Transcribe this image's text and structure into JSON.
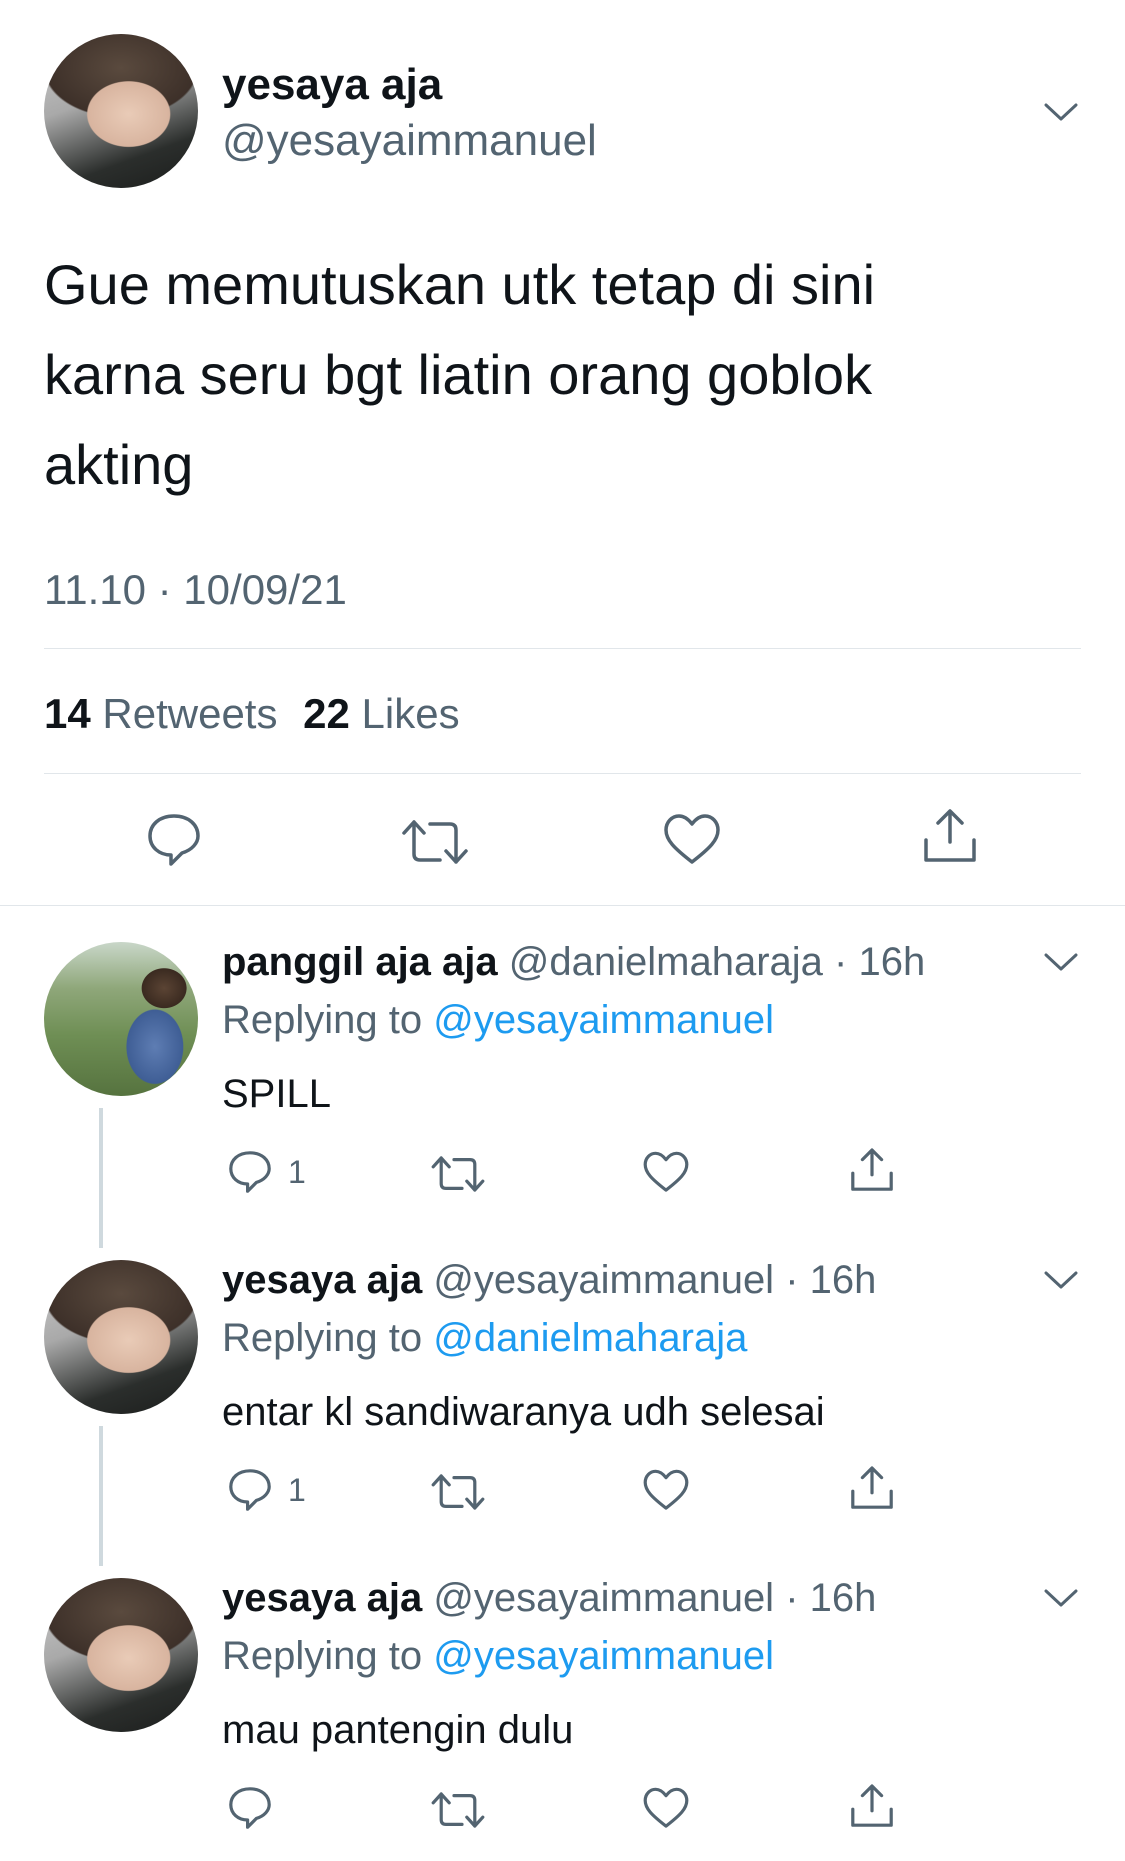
{
  "tweet": {
    "display_name": "yesaya aja",
    "handle": "@yesayaimmanuel",
    "text_lines": [
      "Gue memutuskan utk tetap di sini",
      "karna seru bgt liatin orang goblok",
      "akting"
    ],
    "time": "11.10 · 10/09/21",
    "retweets_count": "14",
    "retweets_label": "Retweets",
    "likes_count": "22",
    "likes_label": "Likes",
    "actions": [
      "reply-icon",
      "retweet-icon",
      "like-icon",
      "share-icon"
    ]
  },
  "replies": [
    {
      "display_name": "panggil aja aja",
      "handle": "@danielmaharaja",
      "time": "· 16h",
      "replying_prefix": "Replying to",
      "replying_to": "@yesayaimmanuel",
      "text": "SPILL",
      "reply_count": "1"
    },
    {
      "display_name": "yesaya aja",
      "handle": "@yesayaimmanuel",
      "time": "· 16h",
      "replying_prefix": "Replying to",
      "replying_to": "@danielmaharaja",
      "text": "entar kl sandiwaranya udh selesai",
      "reply_count": "1"
    },
    {
      "display_name": "yesaya aja",
      "handle": "@yesayaimmanuel",
      "time": "· 16h",
      "replying_prefix": "Replying to",
      "replying_to": "@yesayaimmanuel",
      "text": "mau pantengin dulu",
      "reply_count": ""
    }
  ],
  "colors": {
    "text": "#0f1419",
    "muted": "#536471",
    "link": "#1d9bf0",
    "divider": "#e1e6ea"
  }
}
